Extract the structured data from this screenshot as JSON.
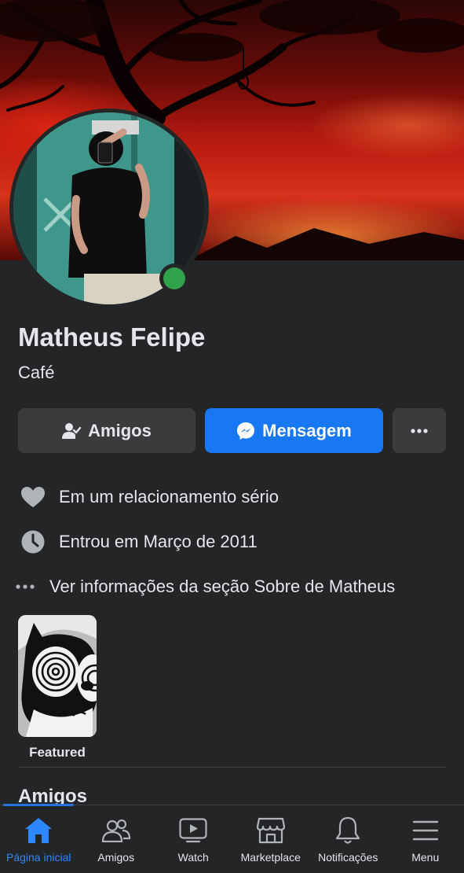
{
  "profile": {
    "name": "Matheus Felipe",
    "bio": "Café",
    "online": true
  },
  "actions": {
    "friends_label": "Amigos",
    "message_label": "Mensagem",
    "more_icon": "more-dots-icon"
  },
  "details": [
    {
      "icon": "heart-icon",
      "text": "Em um relacionamento sério"
    },
    {
      "icon": "clock-icon",
      "text": "Entrou em Março de 2011"
    },
    {
      "icon": "more-dots-icon",
      "text": "Ver informações da seção Sobre de Matheus"
    }
  ],
  "featured": {
    "label": "Featured"
  },
  "sections": {
    "friends_title": "Amigos"
  },
  "tabbar": {
    "items": [
      {
        "label": "Página inicial",
        "icon": "home-icon",
        "active": true
      },
      {
        "label": "Amigos",
        "icon": "friends-icon",
        "active": false
      },
      {
        "label": "Watch",
        "icon": "watch-icon",
        "active": false
      },
      {
        "label": "Marketplace",
        "icon": "marketplace-icon",
        "active": false
      },
      {
        "label": "Notificações",
        "icon": "bell-icon",
        "active": false
      },
      {
        "label": "Menu",
        "icon": "menu-icon",
        "active": false
      }
    ]
  },
  "colors": {
    "background": "#242526",
    "accent": "#1877f2",
    "active_tab": "#2d88ff",
    "online": "#31a24c"
  }
}
